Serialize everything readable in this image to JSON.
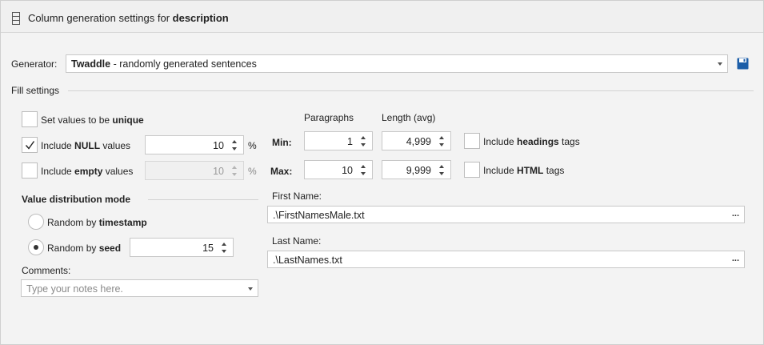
{
  "header": {
    "title_prefix": "Column generation settings for ",
    "title_bold": "description",
    "icon": "column-icon"
  },
  "generator": {
    "label": "Generator:",
    "selected_bold": "Twaddle",
    "selected_rest": " - randomly generated sentences",
    "save_icon": "save-icon"
  },
  "fill_settings": {
    "title": "Fill settings"
  },
  "unique": {
    "text_plain": "Set values to be ",
    "text_bold": "unique",
    "checked": false
  },
  "null_values": {
    "text_plain": "Include ",
    "text_bold": "NULL",
    "text_after": " values",
    "checked": true,
    "value": "10",
    "unit": "%"
  },
  "empty_values": {
    "text_plain": "Include ",
    "text_bold": "empty",
    "text_after": " values",
    "checked": false,
    "value": "10",
    "unit": "%"
  },
  "distribution": {
    "title": "Value distribution mode",
    "timestamp_plain": "Random by ",
    "timestamp_bold": "timestamp",
    "seed_plain": "Random by ",
    "seed_bold": "seed",
    "seed_value": "15",
    "selected": "seed"
  },
  "comments": {
    "label": "Comments:",
    "placeholder": "Type your notes here."
  },
  "paragraphs": {
    "col_paragraphs": "Paragraphs",
    "col_length": "Length (avg)",
    "min_label": "Min:",
    "max_label": "Max:",
    "min_paragraphs": "1",
    "min_length": "4,999",
    "max_paragraphs": "10",
    "max_length": "9,999"
  },
  "headings": {
    "text_plain": "Include ",
    "text_bold": "headings",
    "text_after": " tags",
    "checked": false
  },
  "html_tags": {
    "text_plain": "Include ",
    "text_bold": "HTML",
    "text_after": " tags",
    "checked": false
  },
  "first_name": {
    "label": "First Name:",
    "value": ".\\FirstNamesMale.txt",
    "browse": "..."
  },
  "last_name": {
    "label": "Last Name:",
    "value": ".\\LastNames.txt",
    "browse": "..."
  }
}
